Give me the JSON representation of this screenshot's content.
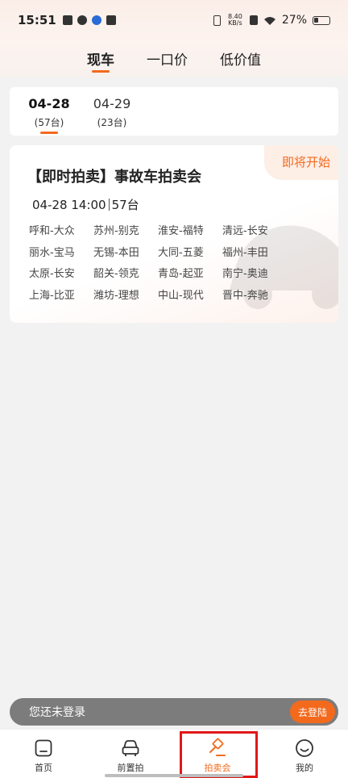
{
  "status_bar": {
    "time": "15:51",
    "net_speed_value": "8.40",
    "net_speed_unit": "KB/s",
    "battery": "27%",
    "battery_level": 0.27
  },
  "tabs": [
    {
      "label": "现车",
      "active": true
    },
    {
      "label": "一口价",
      "active": false
    },
    {
      "label": "低价值",
      "active": false
    }
  ],
  "dates": [
    {
      "date": "04-28",
      "count": "(57台)",
      "active": true
    },
    {
      "date": "04-29",
      "count": "(23台)",
      "active": false
    }
  ],
  "auction": {
    "badge": "即将开始",
    "title": "【即时拍卖】事故车拍卖会",
    "datetime": "04-28 14:00",
    "count": "57台",
    "cities": [
      "呼和-大众",
      "苏州-别克",
      "淮安-福特",
      "清远-长安",
      "丽水-宝马",
      "无锡-本田",
      "大同-五菱",
      "福州-丰田",
      "太原-长安",
      "韶关-领克",
      "青岛-起亚",
      "南宁-奥迪",
      "上海-比亚",
      "潍坊-理想",
      "中山-现代",
      "晋中-奔驰"
    ]
  },
  "login_bar": {
    "text": "您还未登录",
    "button": "去登陆"
  },
  "bottom_nav": [
    {
      "label": "首页",
      "icon": "home-icon"
    },
    {
      "label": "前置拍",
      "icon": "car-icon"
    },
    {
      "label": "拍卖会",
      "icon": "gavel-icon"
    },
    {
      "label": "我的",
      "icon": "smiley-icon"
    }
  ],
  "colors": {
    "accent": "#f36a1d",
    "highlight": "#e01818"
  }
}
